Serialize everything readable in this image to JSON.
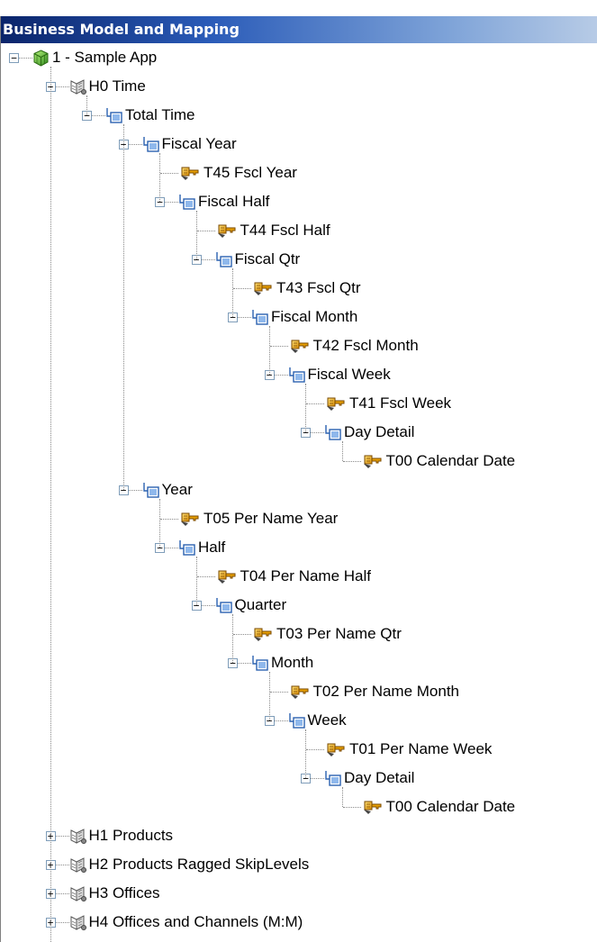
{
  "panel": {
    "title": "Business Model and Mapping"
  },
  "tree": [
    {
      "id": "app",
      "label": "1 - Sample App",
      "icon": "cube-icon",
      "depth": 0,
      "expander": "minus"
    },
    {
      "id": "h0",
      "label": "H0 Time",
      "icon": "hierarchy-icon",
      "depth": 1,
      "expander": "minus"
    },
    {
      "id": "tt",
      "label": "Total Time",
      "icon": "level-icon",
      "depth": 2,
      "expander": "minus"
    },
    {
      "id": "fy",
      "label": "Fiscal Year",
      "icon": "level-icon",
      "depth": 3,
      "expander": "minus"
    },
    {
      "id": "t45",
      "label": "T45 Fscl Year",
      "icon": "key-icon",
      "depth": 4,
      "expander": "none"
    },
    {
      "id": "fh",
      "label": "Fiscal Half",
      "icon": "level-icon",
      "depth": 4,
      "expander": "minus"
    },
    {
      "id": "t44",
      "label": "T44 Fscl Half",
      "icon": "key-icon",
      "depth": 5,
      "expander": "none"
    },
    {
      "id": "fq",
      "label": "Fiscal Qtr",
      "icon": "level-icon",
      "depth": 5,
      "expander": "minus"
    },
    {
      "id": "t43",
      "label": "T43 Fscl Qtr",
      "icon": "key-icon",
      "depth": 6,
      "expander": "none"
    },
    {
      "id": "fm",
      "label": "Fiscal Month",
      "icon": "level-icon",
      "depth": 6,
      "expander": "minus"
    },
    {
      "id": "t42",
      "label": "T42 Fscl Month",
      "icon": "key-icon",
      "depth": 7,
      "expander": "none"
    },
    {
      "id": "fw",
      "label": "Fiscal Week",
      "icon": "level-icon",
      "depth": 7,
      "expander": "minus"
    },
    {
      "id": "t41",
      "label": "T41 Fscl Week",
      "icon": "key-icon",
      "depth": 8,
      "expander": "none"
    },
    {
      "id": "dd1",
      "label": "Day Detail",
      "icon": "level-icon",
      "depth": 8,
      "expander": "minus"
    },
    {
      "id": "t00a",
      "label": "T00 Calendar Date",
      "icon": "key-icon",
      "depth": 9,
      "expander": "none"
    },
    {
      "id": "yr",
      "label": "Year",
      "icon": "level-icon",
      "depth": 3,
      "expander": "minus"
    },
    {
      "id": "t05",
      "label": "T05 Per Name Year",
      "icon": "key-icon",
      "depth": 4,
      "expander": "none"
    },
    {
      "id": "hf",
      "label": "Half",
      "icon": "level-icon",
      "depth": 4,
      "expander": "minus"
    },
    {
      "id": "t04",
      "label": "T04 Per Name Half",
      "icon": "key-icon",
      "depth": 5,
      "expander": "none"
    },
    {
      "id": "qt",
      "label": "Quarter",
      "icon": "level-icon",
      "depth": 5,
      "expander": "minus"
    },
    {
      "id": "t03",
      "label": "T03 Per Name Qtr",
      "icon": "key-icon",
      "depth": 6,
      "expander": "none"
    },
    {
      "id": "mo",
      "label": "Month",
      "icon": "level-icon",
      "depth": 6,
      "expander": "minus"
    },
    {
      "id": "t02",
      "label": "T02 Per Name Month",
      "icon": "key-icon",
      "depth": 7,
      "expander": "none"
    },
    {
      "id": "wk",
      "label": "Week",
      "icon": "level-icon",
      "depth": 7,
      "expander": "minus"
    },
    {
      "id": "t01",
      "label": "T01 Per Name Week",
      "icon": "key-icon",
      "depth": 8,
      "expander": "none"
    },
    {
      "id": "dd2",
      "label": "Day Detail",
      "icon": "level-icon",
      "depth": 8,
      "expander": "minus"
    },
    {
      "id": "t00b",
      "label": "T00 Calendar Date",
      "icon": "key-icon",
      "depth": 9,
      "expander": "none"
    },
    {
      "id": "h1",
      "label": "H1 Products",
      "icon": "hierarchy-icon",
      "depth": 1,
      "expander": "plus"
    },
    {
      "id": "h2",
      "label": "H2 Products Ragged SkipLevels",
      "icon": "hierarchy-icon",
      "depth": 1,
      "expander": "plus"
    },
    {
      "id": "h3",
      "label": "H3 Offices",
      "icon": "hierarchy-icon",
      "depth": 1,
      "expander": "plus"
    },
    {
      "id": "h4",
      "label": "H4 Offices and Channels (M:M)",
      "icon": "hierarchy-icon",
      "depth": 1,
      "expander": "plus"
    }
  ],
  "colors": {
    "title_bg": "#0a246a",
    "expander_border": "#7f9db9",
    "tree_lines": "#8a8a8a"
  }
}
